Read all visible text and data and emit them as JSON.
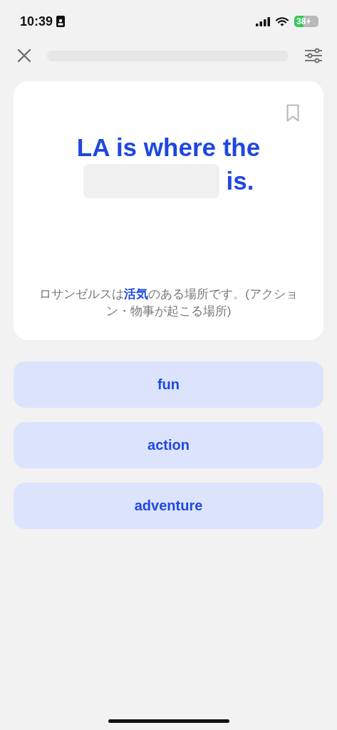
{
  "status_bar": {
    "time": "10:39",
    "battery": "38",
    "charging": true
  },
  "progress": {
    "level": 0
  },
  "card": {
    "bookmarked": false,
    "sentence_before": "LA is where the",
    "sentence_after": "is.",
    "translation": "ロサンゼルスは**活気**のある場所です。(アクション・物事が起こる場所)"
  },
  "choices": [
    {
      "label": "fun"
    },
    {
      "label": "action"
    },
    {
      "label": "adventure"
    }
  ]
}
